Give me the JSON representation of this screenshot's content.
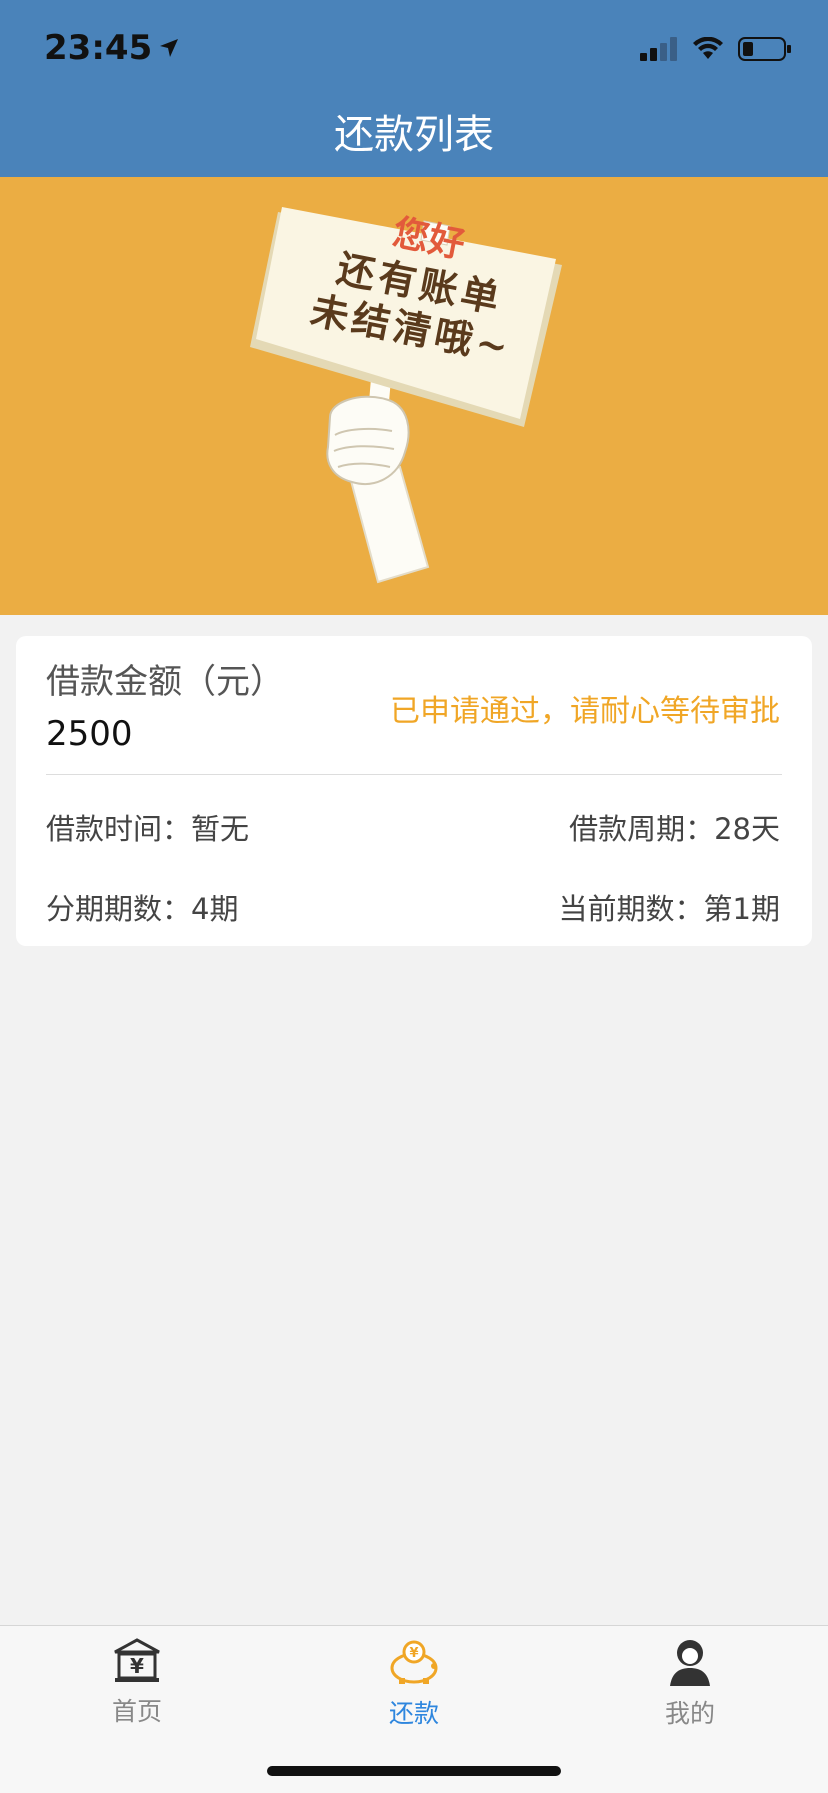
{
  "status_bar": {
    "time": "23:45"
  },
  "header": {
    "title": "还款列表"
  },
  "banner": {
    "sign_line1": "您好",
    "sign_line2": "还有账单",
    "sign_line3": "未结清哦~",
    "colors": {
      "background": "#ebad43",
      "sign": "#faf5e3",
      "greeting": "#e25a3b",
      "text": "#5a3a1c"
    }
  },
  "loan_card": {
    "amount_label": "借款金额（元）",
    "amount_value": "2500",
    "status_message": "已申请通过，请耐心等待审批",
    "loan_time_label": "借款时间：",
    "loan_time_value": "暂无",
    "loan_period_label": "借款周期：",
    "loan_period_value": "28天",
    "installments_label": "分期期数：",
    "installments_value": "4期",
    "current_period_label": "当前期数：",
    "current_period_value": "第1期"
  },
  "tabbar": {
    "tabs": [
      {
        "label": "首页",
        "icon": "bank-icon",
        "active": false
      },
      {
        "label": "还款",
        "icon": "piggy-bank-icon",
        "active": true
      },
      {
        "label": "我的",
        "icon": "user-icon",
        "active": false
      }
    ],
    "active_color": "#2e86de",
    "inactive_color": "#888888"
  }
}
